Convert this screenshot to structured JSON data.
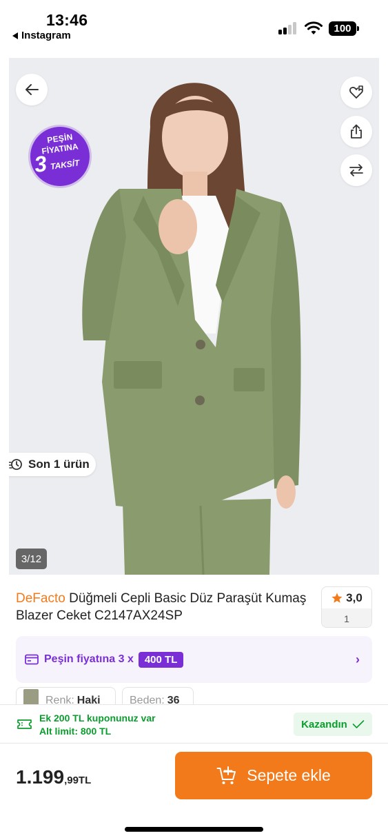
{
  "status_bar": {
    "time": "13:46",
    "back_app": "Instagram",
    "battery": "100"
  },
  "gallery": {
    "promo_badge": {
      "line1": "PEŞİN",
      "line2": "FİYATINA",
      "line3": "3",
      "line4": "TAKSİT"
    },
    "stock_label": "Son 1 ürün",
    "counter": "3/12"
  },
  "product": {
    "brand": "DeFacto",
    "name": " Düğmeli Cepli Basic Düz Paraşüt Kumaş Blazer Ceket C2147AX24SP",
    "rating": "3,0",
    "rating_count": "1"
  },
  "installment": {
    "text": "Peşin fiyatına 3 x",
    "amount": "400 TL"
  },
  "variants": {
    "color_label": "Renk:",
    "color_value": "Haki",
    "size_label": "Beden:",
    "size_value": "36"
  },
  "coupon": {
    "line1": "Ek 200 TL kuponunuz var",
    "line2": "Alt limit: 800 TL",
    "earned_label": "Kazandın"
  },
  "purchase": {
    "price_main": "1.199",
    "price_decimal": ",99TL",
    "add_to_cart": "Sepete ekle"
  },
  "colors": {
    "brand_orange": "#f27a1a",
    "purple": "#7a2fd6",
    "green": "#0b9d2d"
  }
}
